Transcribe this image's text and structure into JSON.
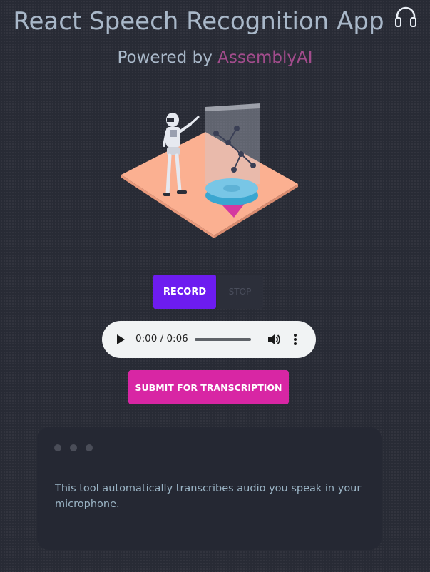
{
  "header": {
    "title": "React Speech Recognition App",
    "subtitle_prefix": "Powered by",
    "subtitle_brand": "AssemblyAI",
    "title_icon": "headphones-icon"
  },
  "controls": {
    "record_label": "RECORD",
    "stop_label": "STOP",
    "submit_label": "SUBMIT FOR TRANSCRIPTION"
  },
  "audio": {
    "time": "0:00 / 0:06",
    "progress": 0,
    "icons": [
      "play-icon",
      "volume-icon",
      "more-vert-icon"
    ]
  },
  "transcript": {
    "text": "This tool automatically transcribes audio you speak in your microphone."
  },
  "colors": {
    "background": "#282b35",
    "record": "#6d1cf0",
    "submit": "#d826a4",
    "brand": "#a24c8c",
    "text": "#a9b8c9"
  }
}
